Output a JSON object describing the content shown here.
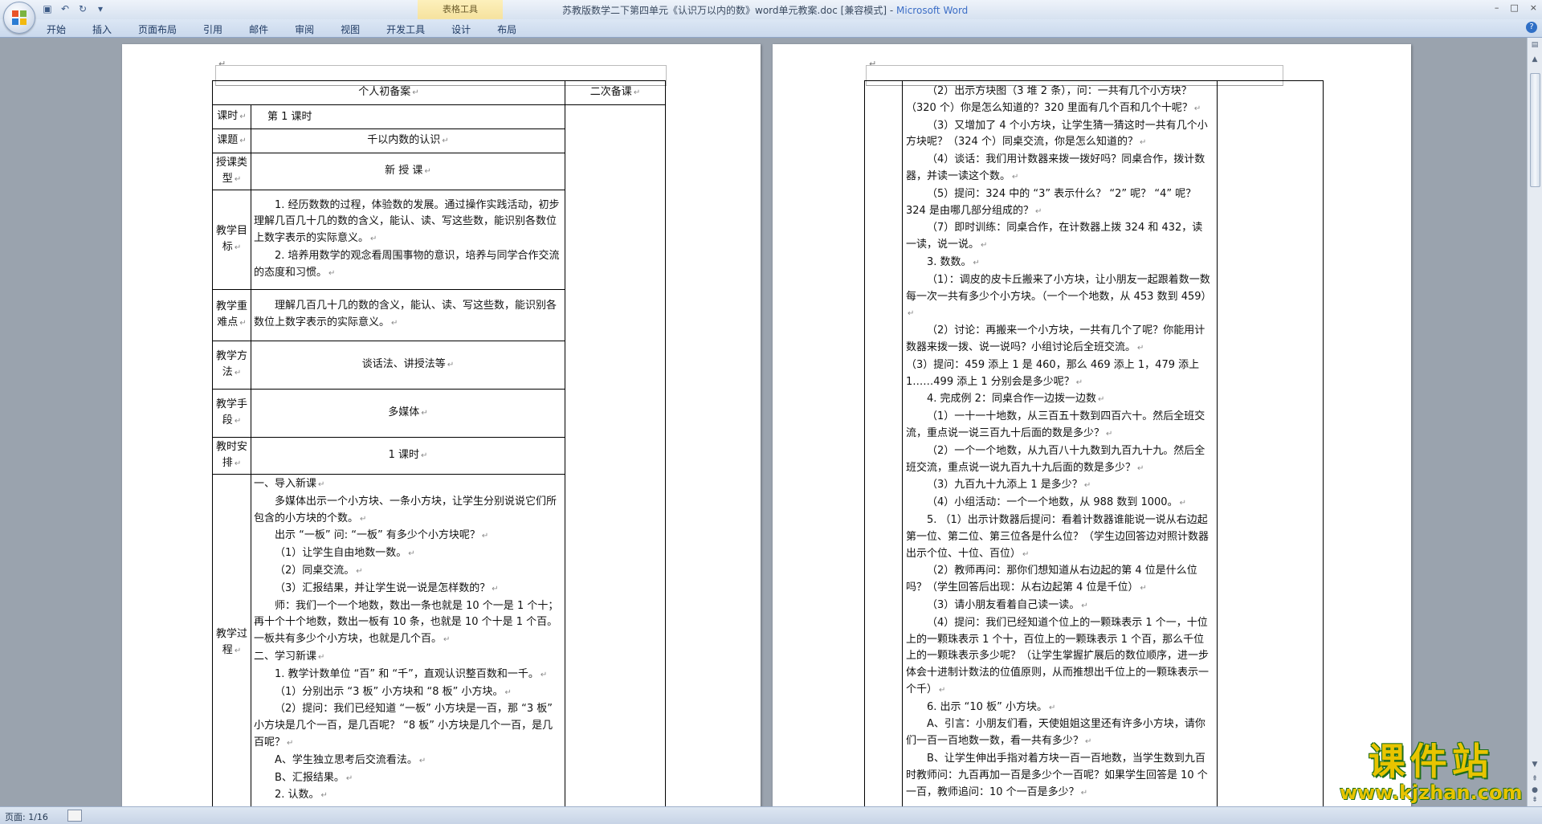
{
  "window": {
    "title": "苏教版数学二下第四单元《认识万以内的数》word单元教案.doc [兼容模式] - ",
    "app_name": "Microsoft Word",
    "context_tab_group": "表格工具",
    "controls": [
      "–",
      "□",
      "×"
    ]
  },
  "ribbon": {
    "tabs": [
      "开始",
      "插入",
      "页面布局",
      "引用",
      "邮件",
      "审阅",
      "视图",
      "开发工具",
      "设计",
      "布局"
    ],
    "help": "?"
  },
  "status": {
    "page": "页面: 1/16"
  },
  "paragraph_mark": "↵",
  "page1": {
    "header_personal": "个人初备案",
    "header_second": "二次备课",
    "rows": [
      {
        "label": "课时",
        "content": "第    1    课时"
      },
      {
        "label": "课题",
        "content": "千以内数的认识"
      },
      {
        "label": "授课类型",
        "content": "新 授 课"
      },
      {
        "label": "教学目标",
        "paras": [
          "1. 经历数数的过程，体验数的发展。通过操作实践活动，初步理解几百几十几的数的含义，能认、读、写这些数，能识别各数位上数字表示的实际意义。",
          "2. 培养用数学的观念看周围事物的意识，培养与同学合作交流的态度和习惯。"
        ]
      },
      {
        "label": "教学重难点",
        "paras": [
          "理解几百几十几的数的含义，能认、读、写这些数，能识别各数位上数字表示的实际意义。"
        ]
      },
      {
        "label": "教学方法",
        "content": "谈话法、讲授法等"
      },
      {
        "label": "教学手段",
        "content": "多媒体"
      },
      {
        "label": "教时安排",
        "content": "1 课时"
      },
      {
        "label": "教学过程",
        "paras": [
          "一、导入新课",
          "多媒体出示一个小方块、一条小方块，让学生分别说说它们所包含的小方块的个数。",
          "出示 “一板” 问: “一板” 有多少个小方块呢？",
          "（1）让学生自由地数一数。",
          "（2）同桌交流。",
          "（3）汇报结果，并让学生说一说是怎样数的？",
          "师：我们一个一个地数，数出一条也就是 10 个一是 1 个十；再十个十个地数，数出一板有 10 条，也就是 10 个十是 1 个百。 一板共有多少个小方块，也就是几个百。",
          "二、学习新课",
          "1. 教学计数单位 “百” 和 “千”，直观认识整百数和一千。",
          "（1）分别出示 “3 板” 小方块和 “8 板” 小方块。",
          "（2）提问：我们已经知道 “一板” 小方块是一百，那 “3 板” 小方块是几个一百，是几百呢？ “8 板” 小方块是几个一百，是几百呢？",
          "A、学生独立思考后交流看法。",
          "B、汇报结果。",
          "2. 认数。"
        ]
      }
    ]
  },
  "page2": {
    "paras": [
      "（2）出示方块图（3 堆 2 条），问：一共有几个小方块？（320 个）你是怎么知道的？320 里面有几个百和几个十呢？",
      "（3）又增加了 4 个小方块，让学生猜一猜这时一共有几个小方块呢？（324 个）同桌交流，你是怎么知道的？",
      "（4）谈话：我们用计数器来拨一拨好吗？同桌合作，拨计数器，并读一读这个数。",
      "（5）提问：324 中的 “3” 表示什么？ “2” 呢？ “4” 呢？324 是由哪几部分组成的？",
      "（7）即时训练：同桌合作，在计数器上拨 324 和 432，读一读，说一说。",
      "3. 数数。",
      "（1）：调皮的皮卡丘搬来了小方块，让小朋友一起跟着数一数每一次一共有多少个小方块。（一个一个地数，从 453 数到 459）",
      "（2）讨论：再搬来一个小方块，一共有几个了呢？你能用计数器来拨一拨、说一说吗？小组讨论后全班交流。",
      "（3）提问：459 添上 1 是 460，那么 469 添上 1，479 添上 1……499 添上 1 分别会是多少呢？",
      "4. 完成例 2：同桌合作一边拨一边数",
      "（1）一十一十地数，从三百五十数到四百六十。然后全班交流，重点说一说三百九十后面的数是多少？",
      "（2）一个一个地数，从九百八十九数到九百九十九。然后全班交流，重点说一说九百九十九后面的数是多少？",
      "（3）九百九十九添上 1 是多少？",
      "（4）小组活动：一个一个地数，从 988 数到 1000。",
      "5. （1）出示计数器后提问：看着计数器谁能说一说从右边起第一位、第二位、第三位各是什么位？（学生边回答边对照计数器出示个位、十位、百位）",
      "（2）教师再问：那你们想知道从右边起的第 4 位是什么位吗？（学生回答后出现：从右边起第 4 位是千位）",
      "（3）请小朋友看着自己读一读。",
      "（4）提问：我们已经知道个位上的一颗珠表示 1 个一，十位上的一颗珠表示 1 个十，百位上的一颗珠表示 1 个百，那么千位上的一颗珠表示多少呢？（让学生掌握扩展后的数位顺序，进一步体会十进制计数法的位值原则，从而推想出千位上的一颗珠表示一个千）",
      "6. 出示 “10 板” 小方块。",
      "A、引言：小朋友们看，天使姐姐这里还有许多小方块，请你们一百一百地数一数，看一共有多少？",
      "B、让学生伸出手指对着方块一百一百地数，当学生数到九百时教师问：九百再加一百是多少个一百呢？如果学生回答是 10 个一百，教师追问：10 个一百是多少？"
    ]
  },
  "watermark": {
    "text": "课件站",
    "url": "www.kjzhan.com"
  }
}
